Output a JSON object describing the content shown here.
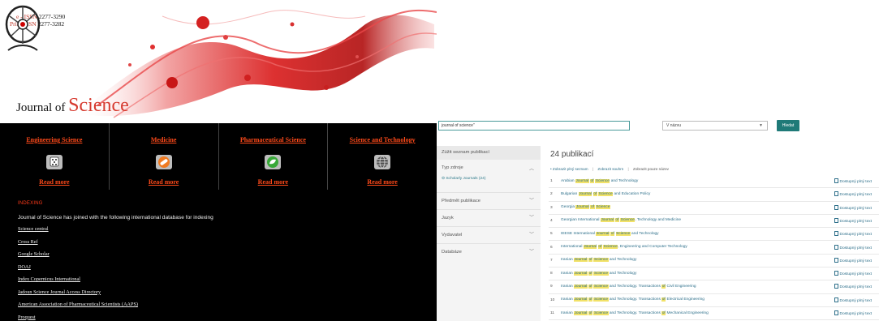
{
  "site": {
    "issn_e_label": "e - ISSN",
    "issn_e_value": "2277-3290",
    "issn_print_label": "Print ISSN",
    "issn_print_value": "2277-3282",
    "title_prefix": "Journal of",
    "title_main": "Science",
    "categories": [
      {
        "title": "Engineering Science",
        "icon": "dice-icon",
        "more": "Read more"
      },
      {
        "title": "Medicine",
        "icon": "pill-icon",
        "more": "Read more"
      },
      {
        "title": "Pharmaceutical Science",
        "icon": "leaf-icon",
        "more": "Read more"
      },
      {
        "title": "Science and Technology",
        "icon": "globe-icon",
        "more": "Read more"
      }
    ],
    "indexing_heading": "INDEXING",
    "indexing_text": "Journal of Science has joined with the following international database for indexing",
    "indexing_list": [
      "Science central",
      "Cross Ref",
      "Google Scholar",
      "DOAJ",
      "Index Copernicus International",
      "Jadoun Science Journal Access Directory",
      "American Association of Pharmaceutical Scientists (AAPS)",
      "Proquest"
    ],
    "colors": {
      "accent": "#ff4a1a",
      "title_red": "#d63a2f",
      "dark_bg": "#000000"
    }
  },
  "search": {
    "query": "journal of science\"",
    "scope": "V názvu",
    "button": "Hledat",
    "sidebar_heading": "Zúžit seznam publikací",
    "facets": {
      "source": {
        "label": "Typ zdroje",
        "option": "Scholarly Journals (24)"
      },
      "subject": "Předmět publikace",
      "language": "Jazyk",
      "publisher": "Vydavatel",
      "database": "Databáze"
    },
    "result_count": "24 publikací",
    "actions": {
      "full_list": "Zobrazit plný seznam",
      "zoom_out": "Zobrazit souhrn",
      "only_titles": "Zobrazit pouze název"
    },
    "access_label": "Dostupný plný text",
    "results": [
      {
        "num": "1",
        "segments": [
          "Arabian ",
          "Journal",
          " ",
          "of",
          " ",
          "Science",
          " and Technology"
        ]
      },
      {
        "num": "2",
        "segments": [
          "Bulgarian ",
          "Journal",
          " ",
          "of",
          " ",
          "Science",
          " and Education Policy"
        ]
      },
      {
        "num": "3",
        "segments": [
          "Georgia ",
          "Journal",
          " ",
          "of",
          " ",
          "Science",
          ""
        ]
      },
      {
        "num": "4",
        "segments": [
          "Georgian International ",
          "Journal",
          " ",
          "of",
          " ",
          "Science",
          ", Technology and Medicine"
        ]
      },
      {
        "num": "5",
        "segments": [
          "IEESE International ",
          "Journal",
          " ",
          "of",
          " ",
          "Science",
          " and Technology"
        ]
      },
      {
        "num": "6",
        "segments": [
          "International ",
          "Journal",
          " ",
          "of",
          " ",
          "Science",
          ", Engineering and Computer Technology"
        ]
      },
      {
        "num": "7",
        "segments": [
          "Iranian ",
          "Journal",
          " ",
          "of",
          " ",
          "Science",
          " and Technology"
        ]
      },
      {
        "num": "8",
        "segments": [
          "Iranian ",
          "Journal",
          " ",
          "of",
          " ",
          "Science",
          " and Technology"
        ]
      },
      {
        "num": "9",
        "segments": [
          "Iranian ",
          "Journal",
          " ",
          "of",
          " ",
          "Science",
          " and Technology. Transactions ",
          "of",
          " Civil Engineering"
        ]
      },
      {
        "num": "10",
        "segments": [
          "Iranian ",
          "Journal",
          " ",
          "of",
          " ",
          "Science",
          " and Technology. Transactions ",
          "of",
          " Electrical Engineering"
        ]
      },
      {
        "num": "11",
        "segments": [
          "Iranian ",
          "Journal",
          " ",
          "of",
          " ",
          "Science",
          " and Technology. Transactions ",
          "of",
          " Mechanical Engineering"
        ]
      }
    ]
  }
}
